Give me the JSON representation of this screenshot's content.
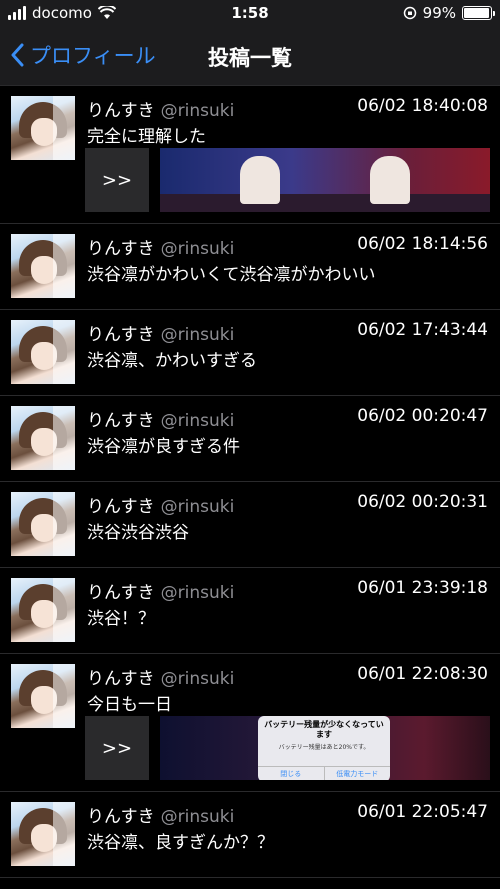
{
  "status_bar": {
    "carrier": "docomo",
    "time": "1:58",
    "battery_percent": "99%"
  },
  "nav": {
    "back_label": "プロフィール",
    "title": "投稿一覧"
  },
  "posts": [
    {
      "name": "りんすき",
      "handle": "@rinsuki",
      "time": "06/02 18:40:08",
      "text": "完全に理解した",
      "media_button": ">>"
    },
    {
      "name": "りんすき",
      "handle": "@rinsuki",
      "time": "06/02 18:14:56",
      "text": "渋谷凛がかわいくて渋谷凛がかわいい"
    },
    {
      "name": "りんすき",
      "handle": "@rinsuki",
      "time": "06/02 17:43:44",
      "text": "渋谷凛、かわいすぎる"
    },
    {
      "name": "りんすき",
      "handle": "@rinsuki",
      "time": "06/02 00:20:47",
      "text": "渋谷凛が良すぎる件"
    },
    {
      "name": "りんすき",
      "handle": "@rinsuki",
      "time": "06/02 00:20:31",
      "text": "渋谷渋谷渋谷"
    },
    {
      "name": "りんすき",
      "handle": "@rinsuki",
      "time": "06/01 23:39:18",
      "text": "渋谷！？"
    },
    {
      "name": "りんすき",
      "handle": "@rinsuki",
      "time": "06/01 22:08:30",
      "text": "今日も一日",
      "media_button": ">>",
      "alert": {
        "title": "バッテリー残量が少なくなっています",
        "message": "バッテリー残量はあと20%です。",
        "close_label": "閉じる",
        "low_power_label": "低電力モード"
      }
    },
    {
      "name": "りんすき",
      "handle": "@rinsuki",
      "time": "06/01 22:05:47",
      "text": "渋谷凛、良すぎんか？？"
    }
  ]
}
